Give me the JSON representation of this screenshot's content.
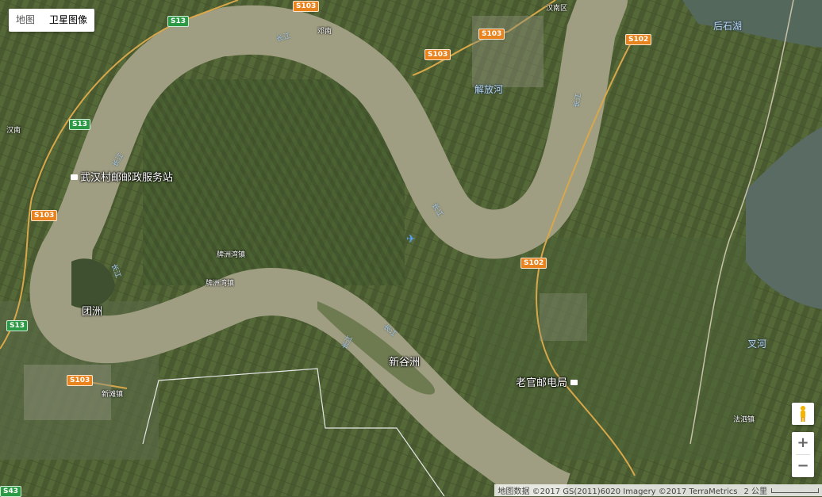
{
  "map_type": {
    "map": "地图",
    "satellite": "卫星图像",
    "selected": "satellite"
  },
  "places": {
    "wuhan_post": "武汉村邮邮政服务站",
    "laoguan_post": "老官邮电局",
    "tuanzhou": "团洲",
    "xinguzhou": "新谷洲",
    "jiefanghe": "解放河",
    "houshihu": "后石湖",
    "chahe": "叉河",
    "hannan_left": "汉南",
    "hannan_district": "汉南区",
    "dengnan": "邓南",
    "paizhouwan_1": "牌洲湾镇",
    "paizhouwan_2": "牌洲湾镇",
    "xintan": "新滩镇",
    "fasi": "法泗镇"
  },
  "rivers": {
    "changjiang": "长江"
  },
  "road_labels": [
    "S103",
    "S103",
    "S103",
    "S103",
    "S103",
    "S13",
    "S13",
    "S13",
    "S102",
    "S102",
    "S43"
  ],
  "controls": {
    "zoom_in": "+",
    "zoom_out": "−"
  },
  "attribution": {
    "text": "地图数据 ©2017 GS(2011)6020 Imagery ©2017 TerraMetrics",
    "scale": "2 公里"
  },
  "colors": {
    "river": "#a09e82",
    "farmland": "#4f5f33",
    "lake": "#596b62",
    "highway": "#e8831e",
    "road_green": "#2c9a45"
  }
}
